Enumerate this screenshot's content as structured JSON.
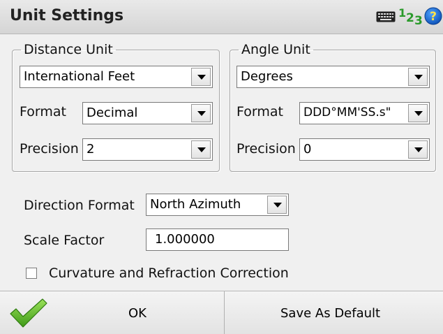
{
  "window": {
    "title": "Unit Settings"
  },
  "header_icons": {
    "keyboard": "keyboard-icon",
    "numeric": {
      "name": "numeric-input-icon",
      "digits": [
        "1",
        "2",
        "3"
      ]
    },
    "help": {
      "name": "help-icon",
      "glyph": "?"
    }
  },
  "distance": {
    "legend": "Distance Unit",
    "unit": "International Feet",
    "format_label": "Format",
    "format": "Decimal",
    "precision_label": "Precision",
    "precision": "2"
  },
  "angle": {
    "legend": "Angle Unit",
    "unit": "Degrees",
    "format_label": "Format",
    "format": "DDD°MM'SS.s\"",
    "precision_label": "Precision",
    "precision": "0"
  },
  "direction": {
    "label": "Direction Format",
    "value": "North Azimuth"
  },
  "scale": {
    "label": "Scale Factor",
    "value": "1.000000"
  },
  "curvature": {
    "label": "Curvature and Refraction Correction",
    "checked": false
  },
  "buttons": {
    "ok": "OK",
    "save_default": "Save As Default"
  },
  "colors": {
    "check_green": "#5fb82a",
    "help_blue": "#1565c0",
    "numeric_green": "#2a9a2a"
  }
}
